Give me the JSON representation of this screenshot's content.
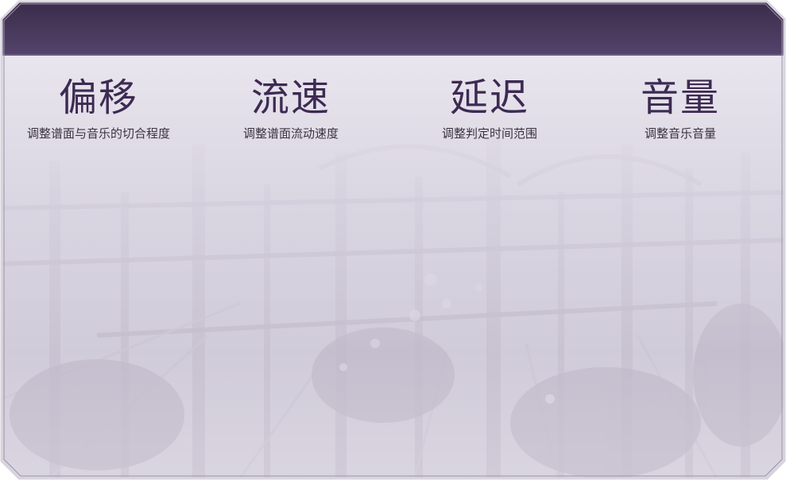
{
  "settings": [
    {
      "title": "偏移",
      "description": "调整谱面与音乐的切合程度"
    },
    {
      "title": "流速",
      "description": "调整谱面流动速度"
    },
    {
      "title": "延迟",
      "description": "调整判定时间范围"
    },
    {
      "title": "音量",
      "description": "调整音乐音量"
    }
  ],
  "colors": {
    "header": "#4a3a5e",
    "title_text": "#3d2a52",
    "description_text": "#3a3340",
    "panel_wash": "#e6e2ec"
  }
}
